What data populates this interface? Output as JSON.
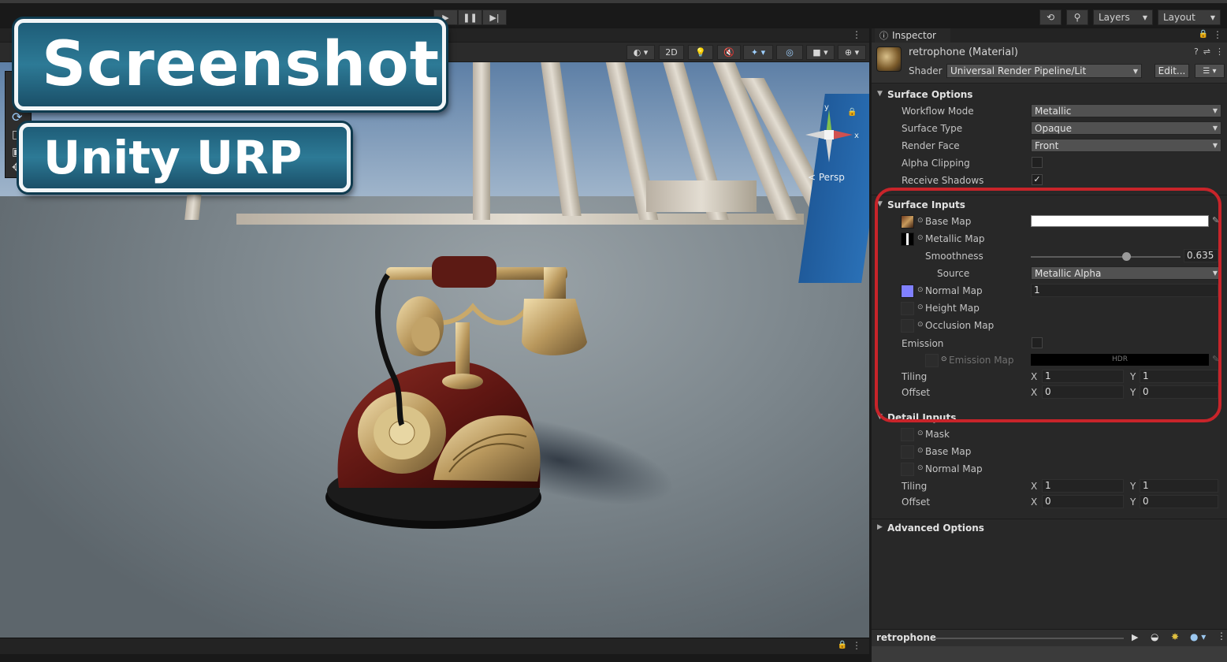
{
  "toolbar": {
    "play_icon": "play-icon",
    "pause_icon": "pause-icon",
    "step_icon": "step-icon",
    "layers_label": "Layers",
    "layout_label": "Layout"
  },
  "scene": {
    "toggle_2d": "2D",
    "persp_label": "< Persp",
    "gizmo_axes": {
      "y": "y",
      "x": "x"
    }
  },
  "overlay": {
    "title": "Screenshot",
    "subtitle": "Unity URP"
  },
  "inspector": {
    "tab_label": "Inspector",
    "material_name": "retrophone (Material)",
    "shader_label": "Shader",
    "shader_value": "Universal Render Pipeline/Lit",
    "edit_label": "Edit...",
    "surface_options": {
      "title": "Surface Options",
      "workflow_mode": {
        "label": "Workflow Mode",
        "value": "Metallic"
      },
      "surface_type": {
        "label": "Surface Type",
        "value": "Opaque"
      },
      "render_face": {
        "label": "Render Face",
        "value": "Front"
      },
      "alpha_clipping": {
        "label": "Alpha Clipping",
        "checked": false
      },
      "receive_shadows": {
        "label": "Receive Shadows",
        "checked": true,
        "mark": "✓"
      }
    },
    "surface_inputs": {
      "title": "Surface Inputs",
      "base_map": "Base Map",
      "metallic_map": "Metallic Map",
      "smoothness": {
        "label": "Smoothness",
        "value": "0.635",
        "fraction": 0.635
      },
      "source": {
        "label": "Source",
        "value": "Metallic Alpha"
      },
      "normal_map": {
        "label": "Normal Map",
        "value": "1"
      },
      "height_map": "Height Map",
      "occlusion_map": "Occlusion Map",
      "emission": {
        "label": "Emission"
      },
      "emission_map": {
        "label": "Emission Map",
        "hdr": "HDR"
      },
      "tiling": {
        "label": "Tiling",
        "x": "1",
        "y": "1"
      },
      "offset": {
        "label": "Offset",
        "x": "0",
        "y": "0"
      }
    },
    "detail_inputs": {
      "title": "Detail Inputs",
      "mask": "Mask",
      "base_map": "Base Map",
      "normal_map": "Normal Map",
      "tiling": {
        "label": "Tiling",
        "x": "1",
        "y": "1"
      },
      "offset": {
        "label": "Offset",
        "x": "0",
        "y": "0"
      }
    },
    "advanced_options": {
      "title": "Advanced Options"
    },
    "axis_x": "X",
    "axis_y": "Y",
    "preview_name": "retrophone"
  },
  "colors": {
    "highlight_outline": "#c8242a",
    "normal_map_swatch": "#8080ff"
  }
}
